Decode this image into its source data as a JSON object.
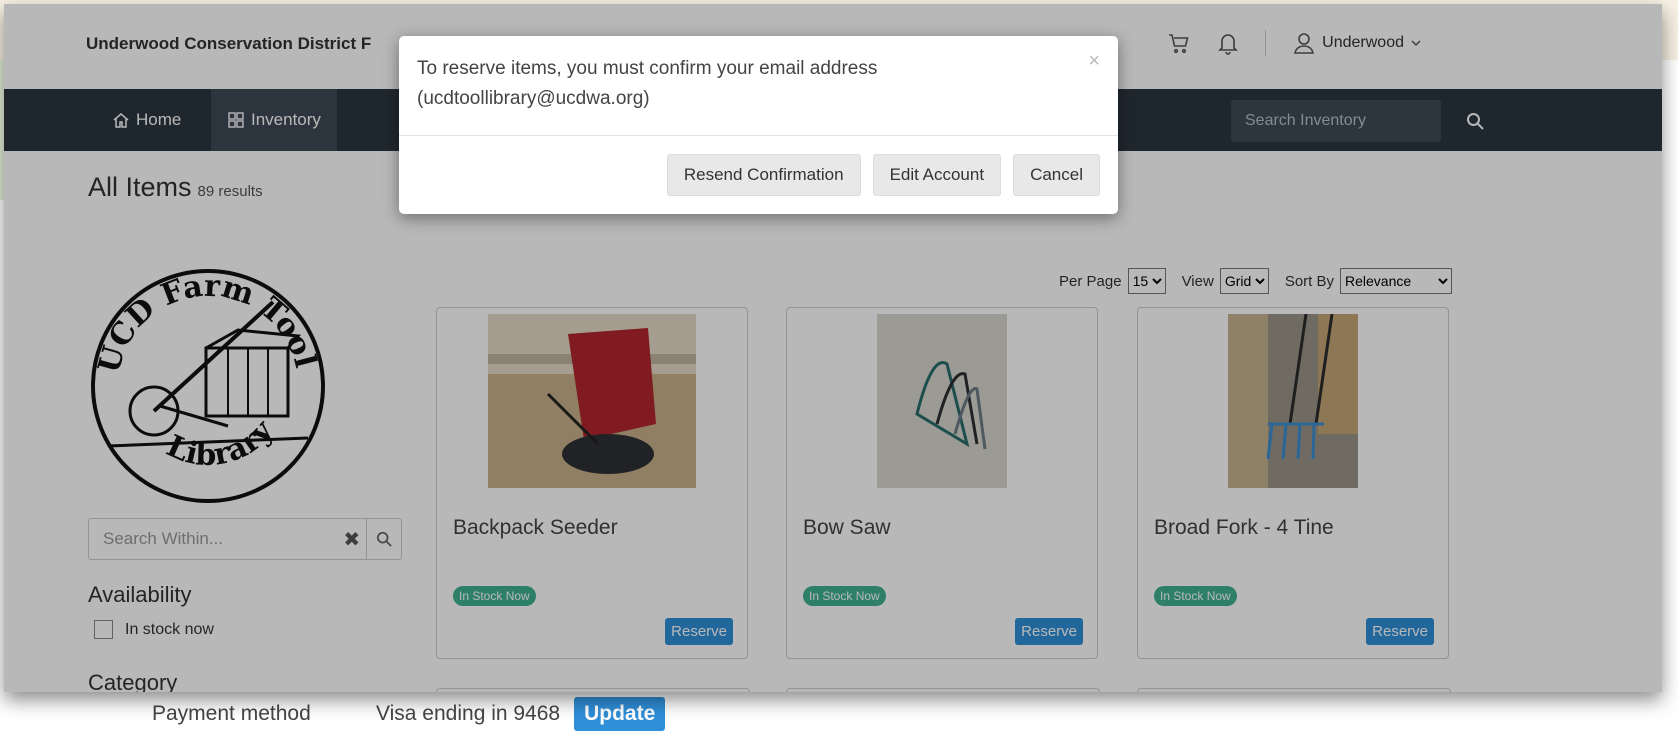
{
  "site": {
    "title": "Underwood Conservation District F"
  },
  "header": {
    "user_name": "Underwood"
  },
  "nav": {
    "home": "Home",
    "inventory": "Inventory",
    "search_placeholder": "Search Inventory"
  },
  "page": {
    "title": "All Items",
    "results": "89 results"
  },
  "logo": {
    "top_text": "UCD Farm Tool",
    "bottom_text": "Library"
  },
  "sidebar": {
    "search_placeholder": "Search Within...",
    "availability_heading": "Availability",
    "availability_option": "In stock now",
    "category_heading": "Category"
  },
  "controls": {
    "per_page_label": "Per Page",
    "per_page_value": "15",
    "view_label": "View",
    "view_value": "Grid",
    "sort_label": "Sort By",
    "sort_value": "Relevance"
  },
  "items": [
    {
      "name": "Backpack Seeder",
      "status": "In Stock Now",
      "action": "Reserve"
    },
    {
      "name": "Bow Saw",
      "status": "In Stock Now",
      "action": "Reserve"
    },
    {
      "name": "Broad Fork - 4 Tine",
      "status": "In Stock Now",
      "action": "Reserve"
    }
  ],
  "modal": {
    "message": "To reserve items, you must confirm your email address (ucdtoollibrary@ucdwa.org)",
    "close": "×",
    "resend": "Resend Confirmation",
    "edit": "Edit Account",
    "cancel": "Cancel"
  },
  "payment": {
    "label": "Payment method",
    "value": "Visa ending in 9468",
    "update": "Update"
  },
  "colors": {
    "navbar": "#2b3640",
    "accent": "#2f8fd8",
    "in_stock": "#3fb28f"
  }
}
